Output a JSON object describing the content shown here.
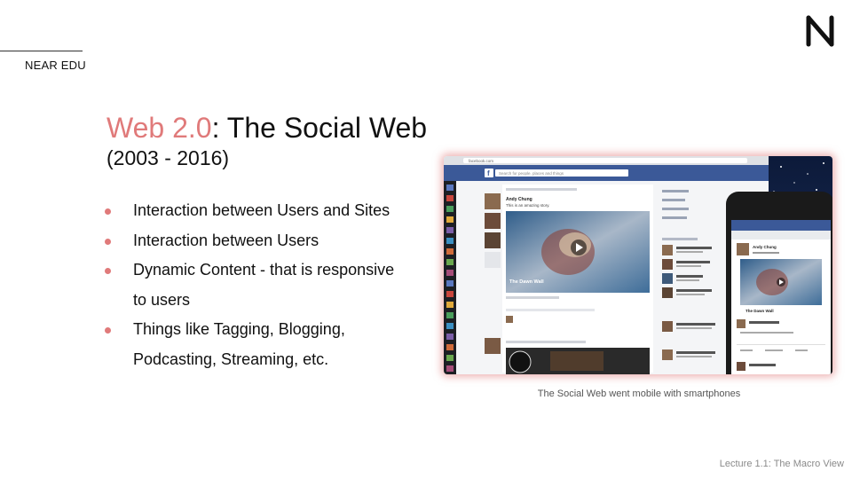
{
  "header": {
    "brand": "NEAR EDU",
    "logo_icon": "near-logo-icon"
  },
  "slide": {
    "title_accent": "Web 2.0",
    "title_rest": ": The Social Web",
    "subtitle": "(2003 - 2016)",
    "bullets": [
      "Interaction between Users and Sites",
      "Interaction between Users",
      "Dynamic Content - that is responsive to users",
      "Things like Tagging, Blogging, Podcasting, Streaming, etc."
    ]
  },
  "screenshot": {
    "url": "facebook.com",
    "search_placeholder": "Search for people, places and things",
    "video_title": "The Dawn Wall",
    "post_author": "Andy Chung",
    "post_text": "This is an amazing story.",
    "phone_author": "Andy Chung",
    "phone_video_title": "The Dawn Wall",
    "caption": "The Social Web went mobile with smartphones"
  },
  "footer": {
    "lecture": "Lecture 1.1: The Macro View"
  },
  "colors": {
    "accent": "#e07a7a",
    "facebook_blue": "#3b5998"
  }
}
